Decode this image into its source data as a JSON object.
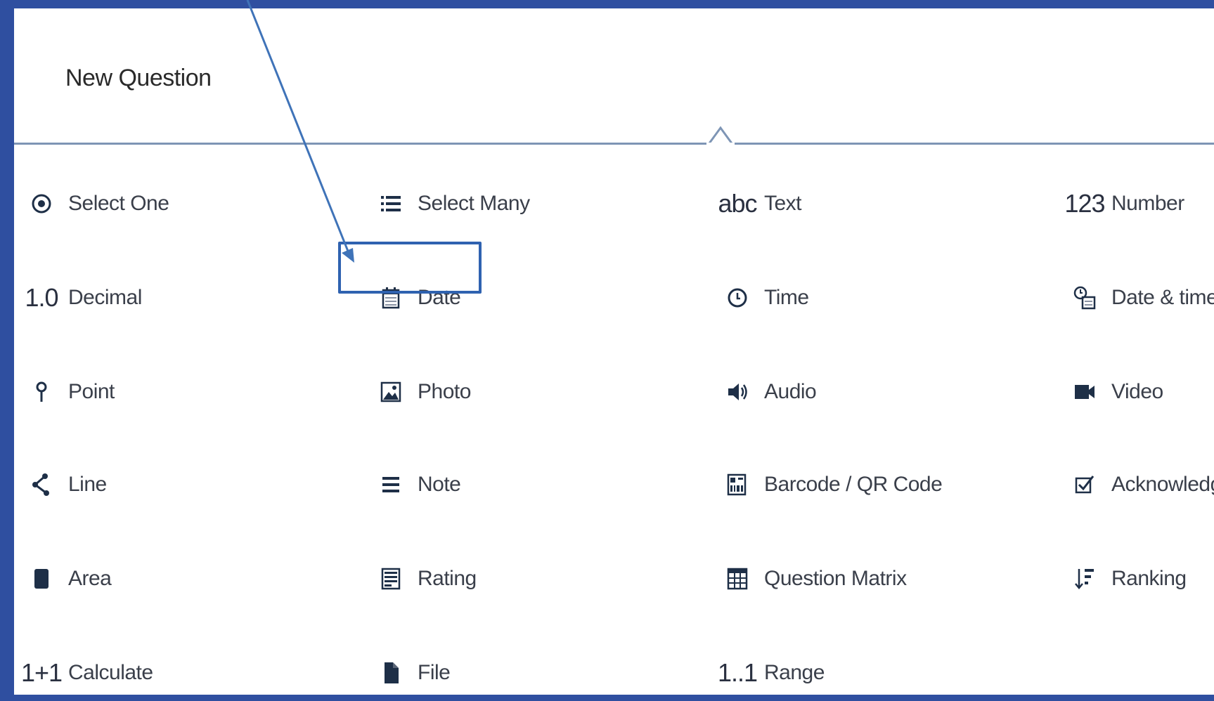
{
  "dialog": {
    "title": "New Question"
  },
  "question_types": [
    {
      "label": "Select One",
      "icon": "radio-target-icon"
    },
    {
      "label": "Select Many",
      "icon": "checklist-icon"
    },
    {
      "label": "Text",
      "icon": "abc-text-icon",
      "glyph": "abc"
    },
    {
      "label": "Number",
      "icon": "number-icon",
      "glyph": "123"
    },
    {
      "label": "Decimal",
      "icon": "decimal-icon",
      "glyph": "1.0"
    },
    {
      "label": "Date",
      "icon": "calendar-icon"
    },
    {
      "label": "Time",
      "icon": "clock-icon"
    },
    {
      "label": "Date & time",
      "icon": "datetime-icon"
    },
    {
      "label": "Point",
      "icon": "pin-icon"
    },
    {
      "label": "Photo",
      "icon": "photo-icon"
    },
    {
      "label": "Audio",
      "icon": "speaker-icon"
    },
    {
      "label": "Video",
      "icon": "video-camera-icon"
    },
    {
      "label": "Line",
      "icon": "line-icon"
    },
    {
      "label": "Note",
      "icon": "note-lines-icon"
    },
    {
      "label": "Barcode / QR Code",
      "icon": "barcode-icon"
    },
    {
      "label": "Acknowledge",
      "icon": "checkbox-icon"
    },
    {
      "label": "Area",
      "icon": "area-icon"
    },
    {
      "label": "Rating",
      "icon": "rating-icon"
    },
    {
      "label": "Question Matrix",
      "icon": "matrix-icon"
    },
    {
      "label": "Ranking",
      "icon": "ranking-icon"
    },
    {
      "label": "Calculate",
      "icon": "calculate-icon",
      "glyph": "1+1"
    },
    {
      "label": "File",
      "icon": "file-icon"
    },
    {
      "label": "Range",
      "icon": "range-icon",
      "glyph": "1..1"
    }
  ],
  "colors": {
    "frame": "#2f4fa0",
    "highlight": "#2f62b0",
    "divider": "#7e95b5"
  },
  "highlighted_item": "Date"
}
